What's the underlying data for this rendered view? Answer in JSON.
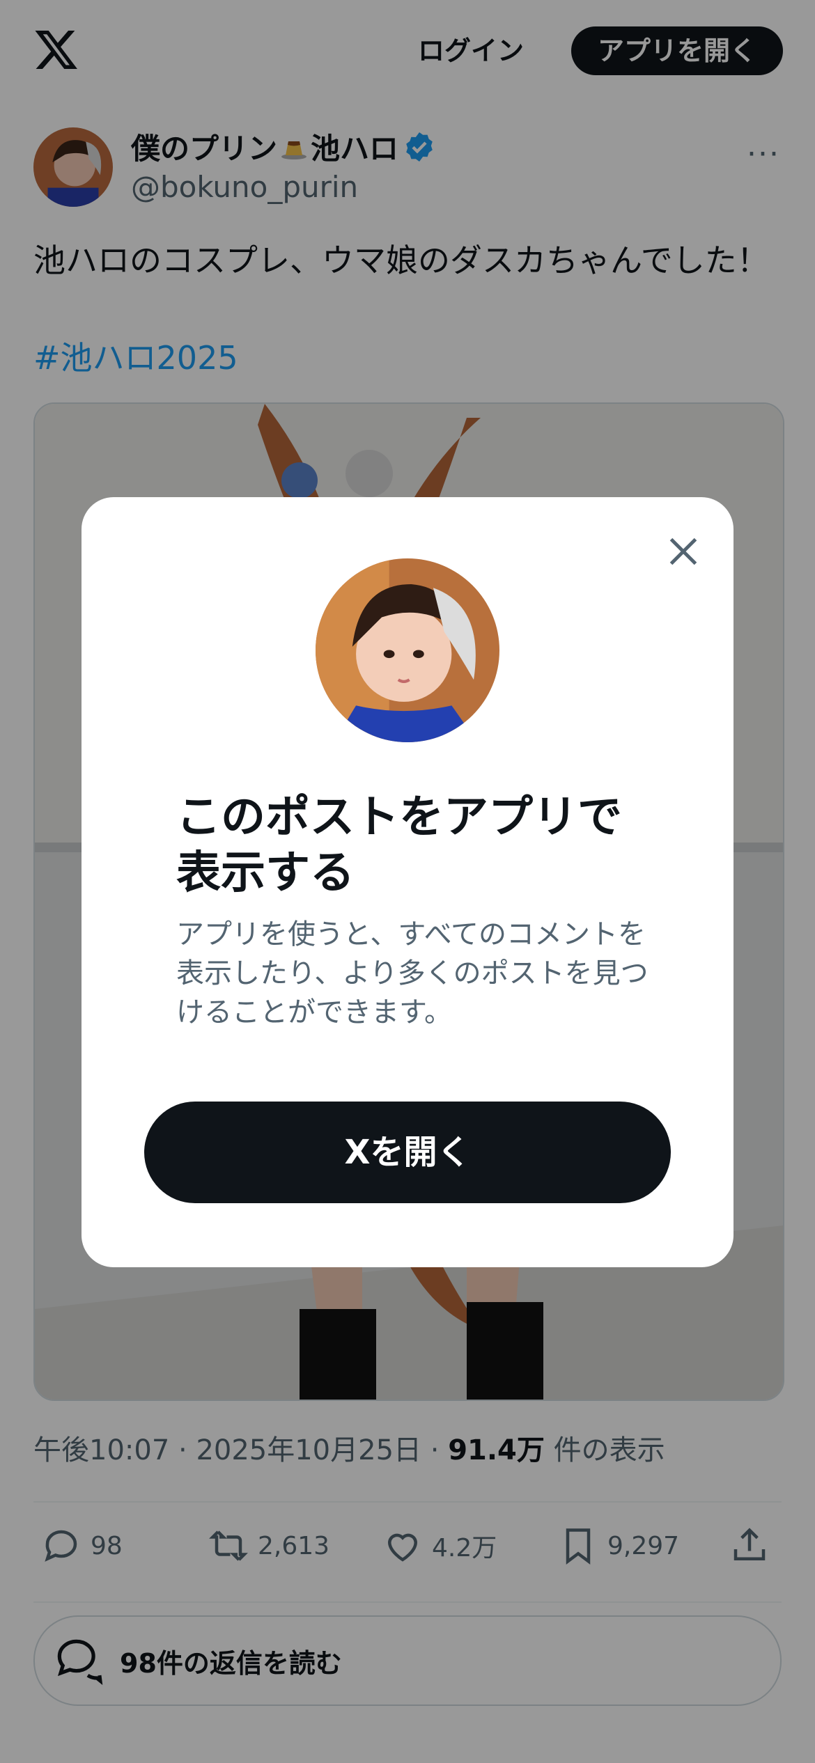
{
  "header": {
    "login_label": "ログイン",
    "open_app_label": "アプリを開く"
  },
  "post": {
    "display_name_prefix": "僕のプリン",
    "display_name_suffix": "池ハロ",
    "handle": "@bokuno_purin",
    "more_label": "···",
    "text": "池ハロのコスプレ、ウマ娘のダスカちゃんでした！",
    "hashtag": "#池ハロ2025",
    "time": "午後10:07",
    "date": "2025年10月25日",
    "views_count": "91.4万",
    "views_label": "件の表示"
  },
  "actions": {
    "replies": "98",
    "reposts": "2,613",
    "likes": "4.2万",
    "bookmarks": "9,297"
  },
  "read_replies_label": "98件の返信を読む",
  "modal": {
    "title": "このポストをアプリで表示する",
    "description": "アプリを使うと、すべてのコメントを表示したり、より多くのポストを見つけることができます。",
    "button_label": "Xを開く"
  },
  "colors": {
    "accent": "#1d9bf0",
    "text": "#0f1419",
    "secondary": "#536471",
    "overlay": "rgba(0,0,0,0.4)"
  }
}
